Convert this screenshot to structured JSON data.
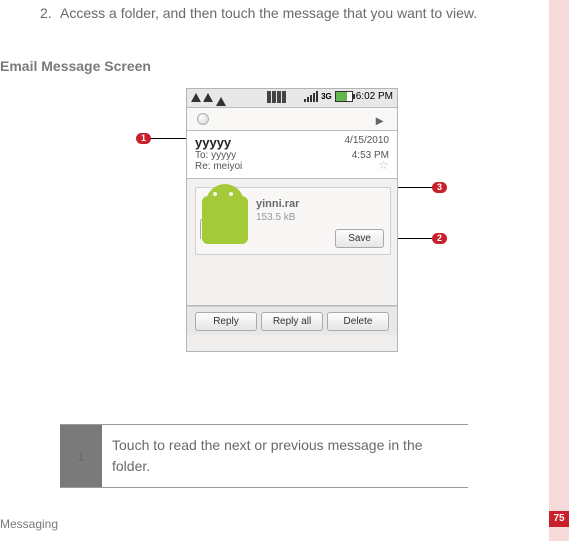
{
  "step": {
    "number": "2.",
    "text": "Access a folder, and then touch the message that you want to view."
  },
  "section_title": "Email Message Screen",
  "callouts": {
    "c1": "1",
    "c2": "2",
    "c3": "3"
  },
  "phone": {
    "time": "6:02 PM",
    "nav_arrow": "▸",
    "from": "yyyyy",
    "to_label": "To:",
    "to_value": "yyyyy",
    "date": "4/15/2010",
    "time2": "4:53 PM",
    "subject_label": "Re:",
    "subject_value": "meiyoi",
    "attachment": {
      "name": "yinni.rar",
      "size": "153.5 kB",
      "save": "Save"
    },
    "buttons": {
      "reply": "Reply",
      "reply_all": "Reply all",
      "delete": "Delete"
    }
  },
  "table": {
    "row1_num": "1",
    "row1_text": "Touch to read the next or previous message in the folder."
  },
  "footer": "Messaging",
  "page_number": "75"
}
